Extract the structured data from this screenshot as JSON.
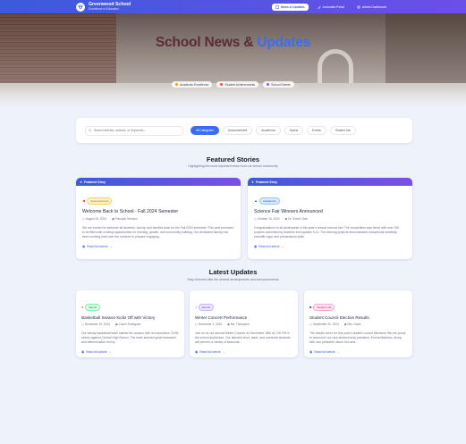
{
  "nav": {
    "brand_name": "Greenwood School",
    "brand_tag": "Excellence in Education",
    "buttons": [
      {
        "label": "News & Updates",
        "active": true
      },
      {
        "label": "Journalist Portal",
        "active": false
      },
      {
        "label": "Admin Dashboard",
        "active": false
      }
    ]
  },
  "hero": {
    "title_main": "School News &",
    "title_highlight": "Updates",
    "pills": [
      {
        "label": "Academic Excellence",
        "color": "#f59e0b"
      },
      {
        "label": "Student Achievements",
        "color": "#ef4444"
      },
      {
        "label": "School Events",
        "color": "#8b5cf6"
      }
    ]
  },
  "filter": {
    "search_placeholder": "Search articles, authors, or keywords...",
    "tabs": [
      "All Categories",
      "Announcement",
      "Academics",
      "Sports",
      "Events",
      "Student Life"
    ]
  },
  "featured": {
    "title": "Featured Stories",
    "subtitle": "Highlighting the most important news from our school community",
    "cards": [
      {
        "band": "Featured Story",
        "category": "Announcement",
        "badge_bg": "#fef3c7",
        "badge_fg": "#b45309",
        "title": "Welcome Back to School - Fall 2024 Semester",
        "date": "August 15, 2024",
        "author": "Principal Johnson",
        "excerpt": "We are excited to welcome all students, faculty, and families back for the Fall 2024 semester! This year promises to be filled with exciting opportunities for learning, growth, and community building. Our dedicated faculty has been working hard over the summer to prepare engaging...",
        "read": "Read full article"
      },
      {
        "band": "Featured Story",
        "category": "Academics",
        "badge_bg": "#dbeafe",
        "badge_fg": "#1d4ed8",
        "title": "Science Fair Winners Announced",
        "date": "October 15, 2024",
        "author": "Dr. Sarah Chen",
        "excerpt": "Congratulations to all participants in this year's annual science fair! The competition was fierce with over 150 projects submitted by students from grades 9-12. The winning projects demonstrated exceptional creativity, scientific rigor, and presentation skills.",
        "read": "Read full article"
      }
    ]
  },
  "latest": {
    "title": "Latest Updates",
    "subtitle": "Stay informed with the newest developments and announcements",
    "cards": [
      {
        "category": "Sports",
        "badge_bg": "#dcfce7",
        "badge_fg": "#15803d",
        "title": "Basketball Season Kicks Off with Victory",
        "date": "November 10, 2024",
        "author": "Coach Rodriguez",
        "excerpt": "Our varsity basketball team started the season with an impressive 78-65 victory against Central High School. The team showed great teamwork and determination led by...",
        "read": "Read full article"
      },
      {
        "category": "Events",
        "badge_bg": "#ede9fe",
        "badge_fg": "#6d28d9",
        "title": "Winter Concert Performance",
        "date": "December 1, 2024",
        "author": "Ms. Thompson",
        "excerpt": "Join us for our annual Winter Concert on December 18th at 7:00 PM in the school auditorium. Our talented choir, band, and orchestra students will perform a variety of seasonal...",
        "read": "Read full article"
      },
      {
        "category": "Student Life",
        "badge_bg": "#fce7f3",
        "badge_fg": "#be185d",
        "title": "Student Council Election Results",
        "date": "September 20, 2024",
        "author": "Mrs. Davis",
        "excerpt": "The results are in for this year's student council elections! We are proud to announce our new student body president, Emma Martinez, along with vice president Jason Kim and...",
        "read": "Read full article"
      }
    ]
  }
}
